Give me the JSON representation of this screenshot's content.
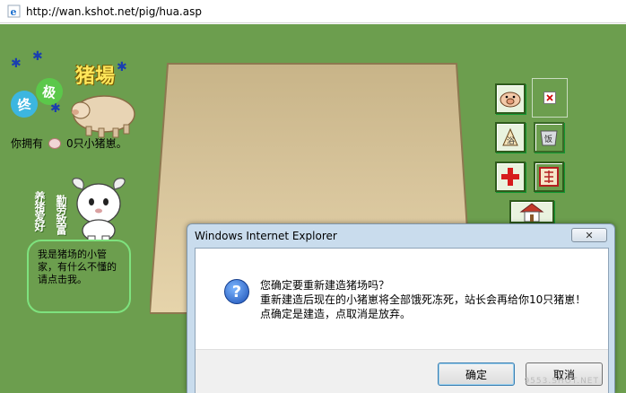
{
  "address_bar": {
    "url": "http://wan.kshot.net/pig/hua.asp"
  },
  "logo": {
    "title": "猪場",
    "badges": [
      "终",
      "极"
    ]
  },
  "ownership": {
    "prefix": "你拥有",
    "count_text": "0只小猪崽。"
  },
  "mascot": {
    "vertical_text_1": "养猪爱好",
    "vertical_text_2": "勤劳致富",
    "bubble_text": "我是猪场的小管家，有什么不懂的请点击我。"
  },
  "toolbar": {
    "icons": [
      "pig-icon",
      "close-x-icon",
      "bath-icon",
      "feed-bowl-icon",
      "red-cross-icon",
      "sign-icon",
      "house-icon"
    ],
    "colors": {
      "accent": "#2f5b1c",
      "cross": "#d61c1c"
    }
  },
  "dialog": {
    "title": "Windows Internet Explorer",
    "close_label": "✕",
    "lines": [
      "您确定要重新建造猪场吗？",
      "重新建造后现在的小猪崽将全部饿死冻死，站长会再给你10只猪崽！",
      "点确定是建造，点取消是放弃。"
    ],
    "ok_label": "确定",
    "cancel_label": "取消",
    "watermark": "9553.SHOT.NET"
  },
  "colors": {
    "page_bg": "#6c9e4e",
    "field": "#d8c59a",
    "dialog_frame": "#c9dced"
  }
}
